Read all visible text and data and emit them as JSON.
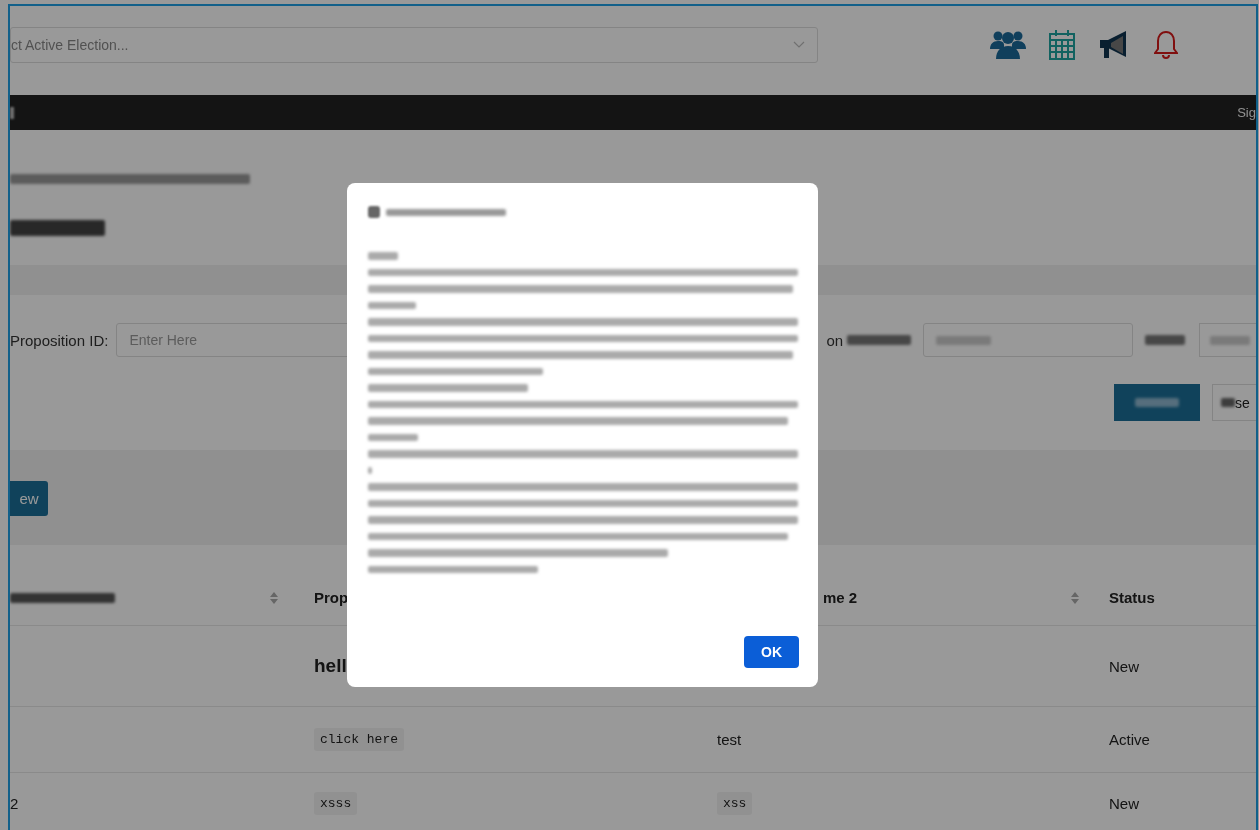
{
  "header": {
    "election_select": {
      "placeholder": "ct Active Election..."
    }
  },
  "navbar": {
    "sign_link": "Sig"
  },
  "filters": {
    "proposition_id": {
      "label": "Proposition ID:",
      "placeholder": "Enter Here"
    },
    "name_label_fragment": "on",
    "reset_fragment": "se"
  },
  "new_button": "ew",
  "table": {
    "columns": [
      {
        "sortable": true
      },
      {
        "label": "Prop"
      },
      {
        "label": "me 2",
        "sortable": true
      },
      {
        "label": "Status"
      }
    ],
    "rows": [
      {
        "cells": [
          null,
          {
            "text": "hell",
            "kind": "heading"
          },
          null,
          {
            "text": "New",
            "kind": "plain"
          }
        ]
      },
      {
        "cells": [
          null,
          {
            "text": "click here",
            "kind": "code"
          },
          {
            "text": "test",
            "kind": "plain"
          },
          {
            "text": "Active",
            "kind": "plain"
          }
        ]
      },
      {
        "cells": [
          {
            "text": "2",
            "kind": "plain"
          },
          {
            "text": "xsss",
            "kind": "code"
          },
          {
            "text": "xss",
            "kind": "code"
          },
          {
            "text": "New",
            "kind": "plain"
          }
        ]
      }
    ]
  },
  "dialog": {
    "ok_button": "OK"
  }
}
